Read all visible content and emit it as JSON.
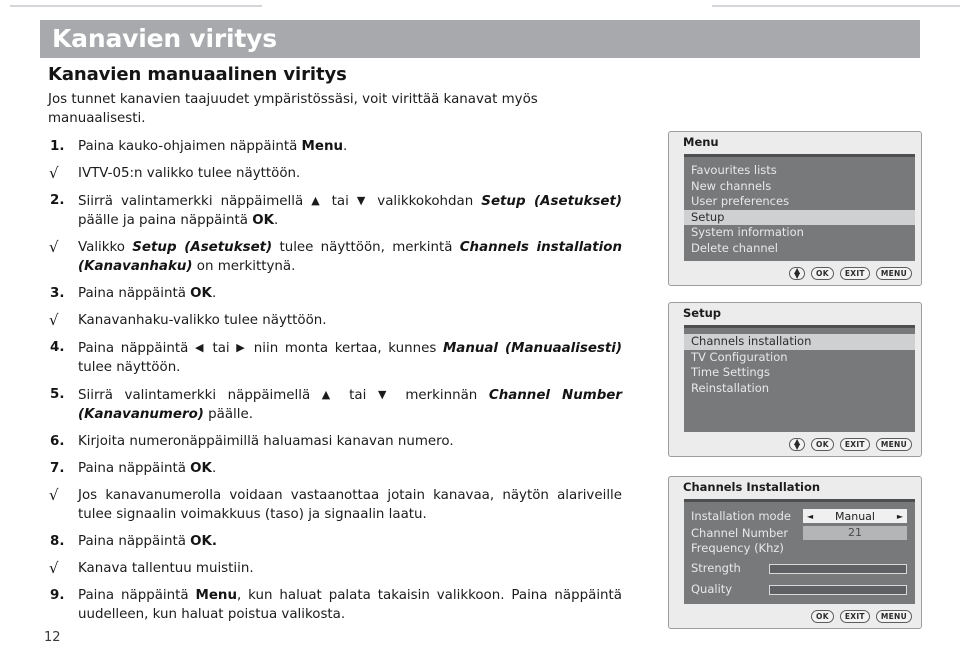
{
  "banner": {
    "title": "Kanavien viritys"
  },
  "article": {
    "subhead": "Kanavien manuaalinen viritys",
    "intro": "Jos tunnet kanavien taajuudet ympäristössäsi, voit virittää kanavat myös manuaalisesti.",
    "steps": [
      {
        "marker": "1.",
        "type": "number",
        "text_html": "Paina kauko-ohjaimen näppäintä <b>Menu</b>."
      },
      {
        "marker": "√",
        "type": "check",
        "text_html": "IVTV-05:n valikko tulee näyttöön."
      },
      {
        "marker": "2.",
        "type": "number",
        "text_html": "Siirrä valintamerkki näppäimellä <span class=\"arrow-g\">▲</span> tai <span class=\"arrow-g\">▼</span> valikkokohdan <i class=\"bi\">Setup (Asetukset)</i> päälle ja paina näppäintä <b>OK</b>."
      },
      {
        "marker": "√",
        "type": "check",
        "text_html": "Valikko <i class=\"bi\">Setup (Asetukset)</i> tulee näyttöön, merkintä <i class=\"bi\">Channels installation (Kanavanhaku)</i> on merkittynä."
      },
      {
        "marker": "3.",
        "type": "number",
        "text_html": "Paina näppäintä <b>OK</b>."
      },
      {
        "marker": "√",
        "type": "check",
        "text_html": "Kanavanhaku-valikko tulee näyttöön."
      },
      {
        "marker": "4.",
        "type": "number",
        "text_html": "Paina näppäintä <span class=\"arrow-g\">◀</span> tai <span class=\"arrow-g\">▶</span> niin monta kertaa, kunnes <i class=\"bi\">Manual (Manuaalisesti)</i> tulee näyttöön."
      },
      {
        "marker": "5.",
        "type": "number",
        "text_html": "Siirrä valintamerkki näppäimellä <span class=\"arrow-g\">▲</span> tai <span class=\"arrow-g\">▼</span> merkinnän <i class=\"bi\">Channel Number (Kanavanumero)</i> päälle."
      },
      {
        "marker": "6.",
        "type": "number",
        "text_html": "Kirjoita numeronäppäimillä haluamasi kanavan numero."
      },
      {
        "marker": "7.",
        "type": "number",
        "text_html": "Paina näppäintä <b>OK</b>."
      },
      {
        "marker": "√",
        "type": "check",
        "text_html": "Jos kanavanumerolla voidaan vastaanottaa jotain kanavaa, näytön alariveille tulee signaalin voimakkuus (taso) ja signaalin laatu."
      },
      {
        "marker": "8.",
        "type": "number",
        "text_html": "Paina näppäintä <b>OK.</b>"
      },
      {
        "marker": "√",
        "type": "check",
        "text_html": "Kanava tallentuu muistiin."
      },
      {
        "marker": "9.",
        "type": "number",
        "text_html": "Paina näppäintä <b>Menu</b>, kun haluat palata takaisin valikkoon. Paina näppäintä uudelleen, kun haluat poistua valikosta."
      }
    ]
  },
  "page_number": "12",
  "tv_panels": {
    "menu": {
      "title": "Menu",
      "items": [
        {
          "label": "Favourites lists",
          "selected": false
        },
        {
          "label": "New channels",
          "selected": false
        },
        {
          "label": "User preferences",
          "selected": false
        },
        {
          "label": "Setup",
          "selected": true
        },
        {
          "label": "System information",
          "selected": false
        },
        {
          "label": "Delete channel",
          "selected": false
        }
      ],
      "keys": [
        "updown",
        "OK",
        "EXIT",
        "MENU"
      ]
    },
    "setup": {
      "title": "Setup",
      "items": [
        {
          "label": "Channels installation",
          "selected": true
        },
        {
          "label": "TV Configuration",
          "selected": false
        },
        {
          "label": "Time Settings",
          "selected": false
        },
        {
          "label": "Reinstallation",
          "selected": false
        }
      ],
      "keys": [
        "updown",
        "OK",
        "EXIT",
        "MENU"
      ]
    },
    "channels_installation": {
      "title": "Channels Installation",
      "fields": {
        "installation_mode_label": "Installation mode",
        "installation_mode_value": "Manual",
        "installation_mode_left_arrow": "◄",
        "installation_mode_right_arrow": "►",
        "channel_number_label": "Channel Number",
        "channel_number_value": "21",
        "frequency_label": "Frequency  (Khz)",
        "strength_label": "Strength",
        "strength_value": "",
        "quality_label": "Quality",
        "quality_value": ""
      },
      "keys": [
        "OK",
        "EXIT",
        "MENU"
      ]
    }
  },
  "key_labels": {
    "ok": "OK",
    "exit": "EXIT",
    "menu": "MENU",
    "up": "▲",
    "down": "▼"
  },
  "colors": {
    "banner": "#a7a9ac",
    "panel_frame": "#ececec",
    "panel_screen": "#77797b",
    "panel_screen_top": "#4d4f51",
    "selection": "#cfd0d1"
  }
}
